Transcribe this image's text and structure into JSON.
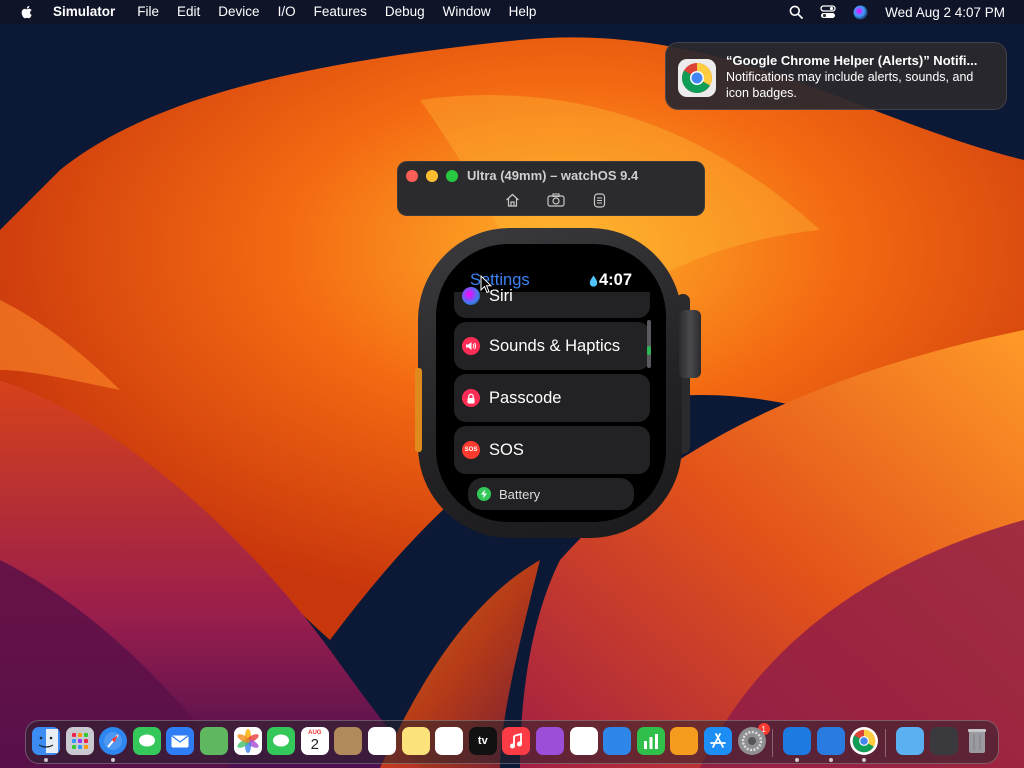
{
  "menubar": {
    "app_name": "Simulator",
    "items": [
      "File",
      "Edit",
      "Device",
      "I/O",
      "Features",
      "Debug",
      "Window",
      "Help"
    ],
    "clock": "Wed Aug 2  4:07 PM"
  },
  "notification": {
    "title": "“Google Chrome Helper (Alerts)” Notifi...",
    "body": "Notifications may include alerts, sounds, and icon badges."
  },
  "simulator": {
    "title": "Ultra (49mm) – watchOS 9.4",
    "tools": [
      "home-icon",
      "screenshot-icon",
      "rotate-icon"
    ]
  },
  "watch": {
    "title": "Settings",
    "time": "4:07",
    "rows": [
      {
        "label": "Siri",
        "color": "#7b4fe0"
      },
      {
        "label": "Sounds & Haptics",
        "color": "#ff2d55"
      },
      {
        "label": "Passcode",
        "color": "#ff2d55"
      },
      {
        "label": "SOS",
        "color": "#ff3b30",
        "icon_text": "SOS"
      },
      {
        "label": "Battery",
        "color": "#34c759"
      }
    ]
  },
  "dock": {
    "calendar_month": "AUG",
    "calendar_day": "2",
    "tv_label": "tv",
    "settings_badge": "1",
    "apps": [
      {
        "name": "finder-icon",
        "color": "#3b8bf2"
      },
      {
        "name": "launchpad-icon",
        "color": "#c9c9d1"
      },
      {
        "name": "safari-icon",
        "color": "#2e86f0"
      },
      {
        "name": "messages-icon",
        "color": "#34c759"
      },
      {
        "name": "mail-icon",
        "color": "#2f7df5"
      },
      {
        "name": "maps-icon",
        "color": "#5fb85f"
      },
      {
        "name": "photos-icon",
        "color": "#ffffff"
      },
      {
        "name": "facetime-icon",
        "color": "#34c759"
      },
      {
        "name": "calendar-icon",
        "color": "#ffffff"
      },
      {
        "name": "contacts-icon",
        "color": "#b08a5a"
      },
      {
        "name": "reminders-icon",
        "color": "#ffffff"
      },
      {
        "name": "notes-icon",
        "color": "#fbe27a"
      },
      {
        "name": "freeform-icon",
        "color": "#ffffff"
      },
      {
        "name": "apple-tv-icon",
        "color": "#111111"
      },
      {
        "name": "music-icon",
        "color": "#fc3c44"
      },
      {
        "name": "podcasts-icon",
        "color": "#9b4fd8"
      },
      {
        "name": "news-icon",
        "color": "#ffffff"
      },
      {
        "name": "keynote-icon",
        "color": "#2d86e8"
      },
      {
        "name": "numbers-icon",
        "color": "#2fbf4a"
      },
      {
        "name": "pages-icon",
        "color": "#f59b1e"
      },
      {
        "name": "app-store-icon",
        "color": "#1c8ef5"
      },
      {
        "name": "system-settings-icon",
        "color": "#8e8e93"
      },
      {
        "name": "xcode-icon",
        "color": "#1d7ae0"
      },
      {
        "name": "simulator-icon",
        "color": "#2a7be0"
      },
      {
        "name": "chrome-icon",
        "color": "#ffffff"
      },
      {
        "name": "downloads-folder-icon",
        "color": "#5ab0f0"
      },
      {
        "name": "screenshot-stack-icon",
        "color": "#3a3a3e"
      },
      {
        "name": "trash-icon",
        "color": "#b8b8bd"
      }
    ]
  }
}
